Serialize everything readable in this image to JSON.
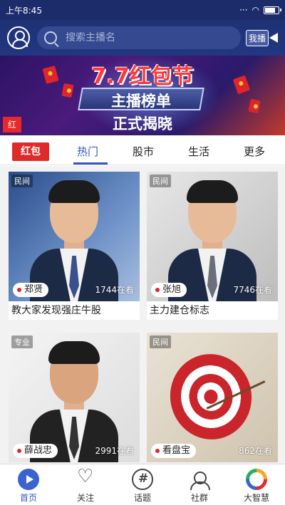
{
  "status_bar": {
    "time": "上午8:45"
  },
  "header": {
    "search_placeholder": "搜索主播名",
    "live_button_label": "我播"
  },
  "banner": {
    "title": "7.7红包节",
    "subtitle": "主播榜单",
    "tagline": "正式揭晓",
    "corner_tag": "红"
  },
  "tabs": {
    "red_packet_label": "红包",
    "items": [
      {
        "label": "热门",
        "active": true
      },
      {
        "label": "股市",
        "active": false
      },
      {
        "label": "生活",
        "active": false
      },
      {
        "label": "更多",
        "active": false
      }
    ]
  },
  "cards": [
    {
      "tag": "民间",
      "name": "郑贤",
      "viewers": "1744在看",
      "caption": "教大家发现强庄牛股"
    },
    {
      "tag": "民间",
      "name": "张旭",
      "viewers": "7746在看",
      "caption": "主力建仓标志"
    },
    {
      "tag": "专业",
      "name": "薛战忠",
      "viewers": "2991在看",
      "caption": ""
    },
    {
      "tag": "民间",
      "name": "看盘宝",
      "viewers": "862在看",
      "caption": ""
    }
  ],
  "bottom_nav": [
    {
      "label": "首页",
      "icon": "home-play-icon",
      "active": true
    },
    {
      "label": "关注",
      "icon": "heart-icon",
      "active": false
    },
    {
      "label": "话题",
      "icon": "topic-hash-icon",
      "active": false
    },
    {
      "label": "社群",
      "icon": "community-icon",
      "active": false
    },
    {
      "label": "大智慧",
      "icon": "dazhihui-logo-icon",
      "active": false
    }
  ],
  "colors": {
    "header_bg": "#1e3174",
    "accent_blue": "#2d59c8",
    "red": "#e02a2a"
  }
}
